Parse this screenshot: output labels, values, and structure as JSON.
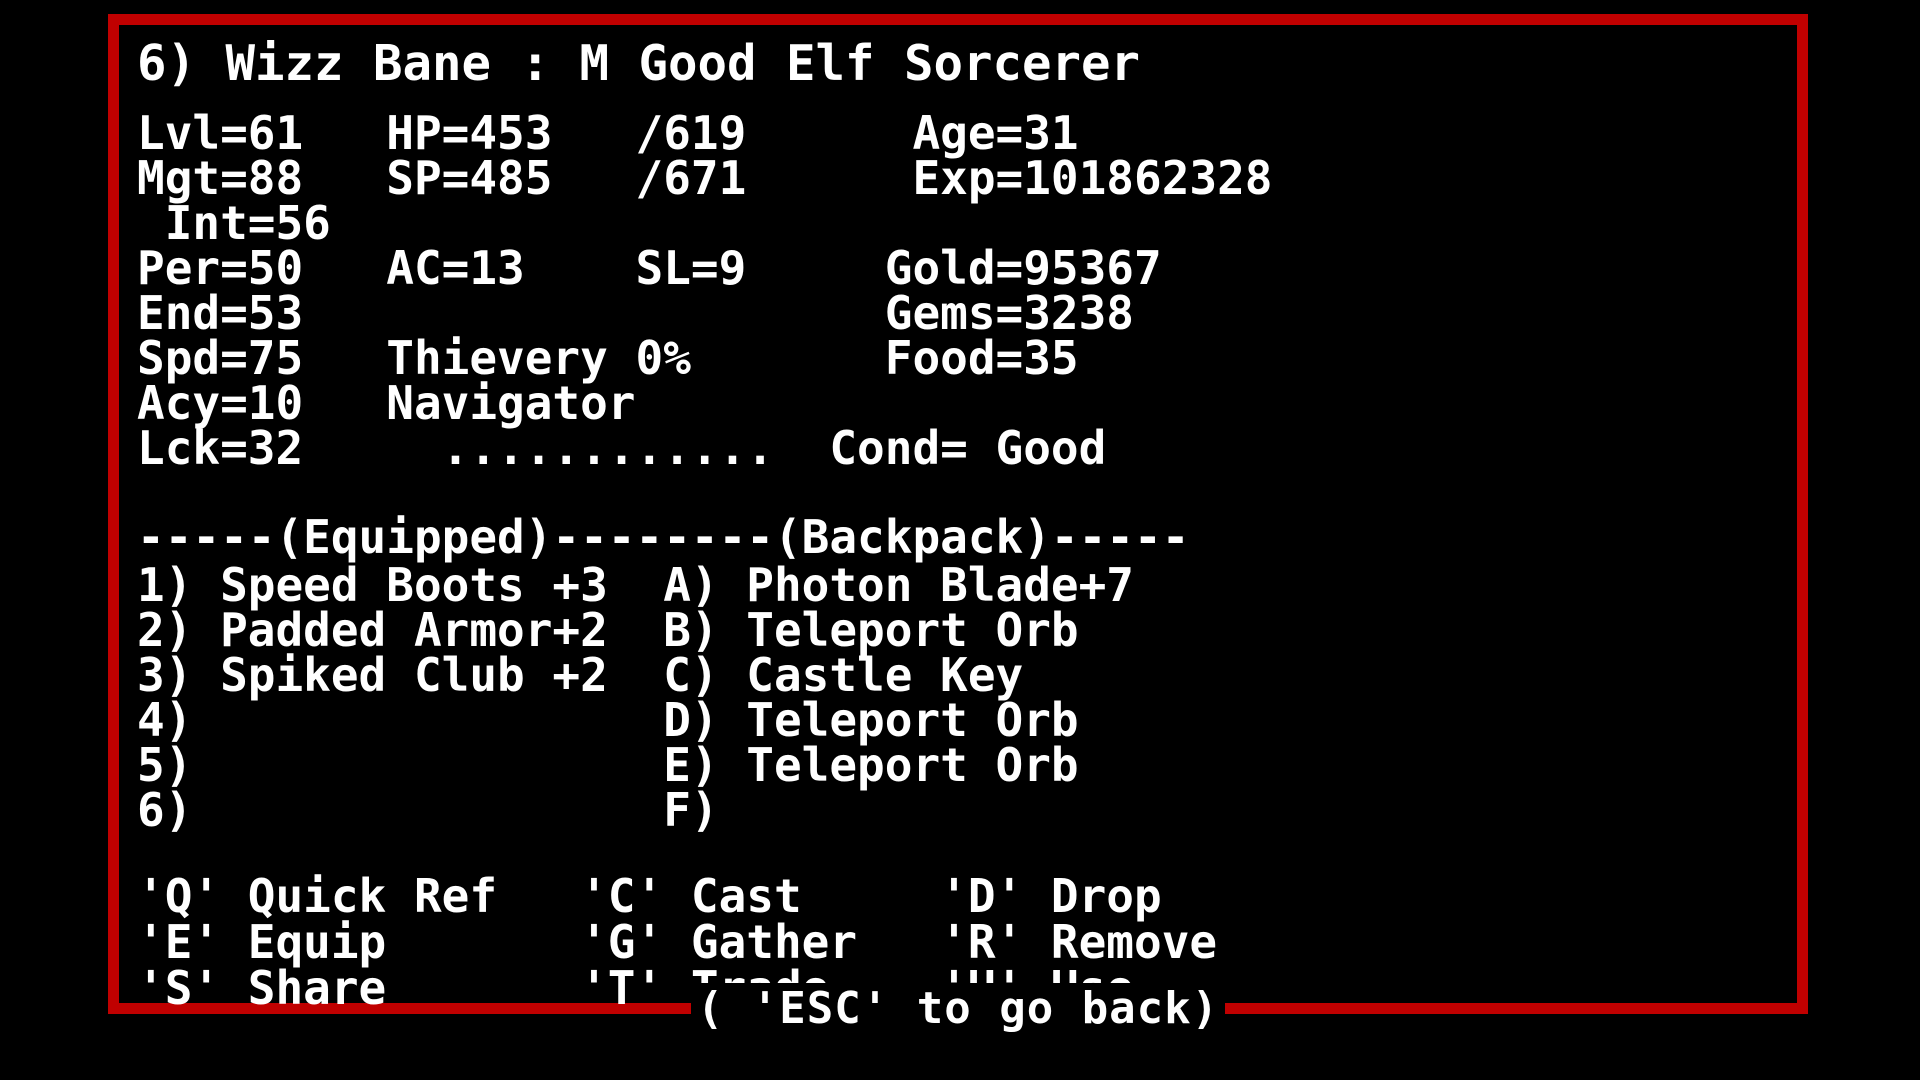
{
  "screen": {
    "background_color": "#000000",
    "text_color": "#ffffff",
    "border_color": "#c00000"
  },
  "header": {
    "line": "6) Wizz Bane : M Good Elf Sorcerer",
    "slot": "6)",
    "name": "Wizz Bane",
    "separator": ":",
    "sex": "M",
    "alignment": "Good",
    "race": "Elf",
    "class": "Sorcerer"
  },
  "stats": {
    "rows": [
      "Lvl=61   HP=453   /619      Age=31",
      "Mgt=88   SP=485   /671      Exp=101862328",
      " Int=56",
      "Per=50   AC=13    SL=9     Gold=95367",
      "End=53                     Gems=3238",
      "Spd=75   Thievery 0%       Food=35",
      "Acy=10   Navigator",
      "Lck=32     ............  Cond= Good"
    ],
    "values": {
      "Lvl": "61",
      "Mgt": "88",
      "Int": "56",
      "Per": "50",
      "End": "53",
      "Spd": "75",
      "Acy": "10",
      "Lck": "32",
      "HP": "453",
      "HP_max": "619",
      "SP": "485",
      "SP_max": "671",
      "AC": "13",
      "SL": "9",
      "Thievery": "0%",
      "Skill": "Navigator",
      "Age": "31",
      "Exp": "101862328",
      "Gold": "95367",
      "Gems": "3238",
      "Food": "35",
      "Cond": "Good"
    },
    "dots": "............"
  },
  "inventory": {
    "divider": "-----(Equipped)--------(Backpack)-----",
    "equipped_label": "(Equipped)",
    "backpack_label": "(Backpack)",
    "rows": [
      "1) Speed Boots +3  A) Photon Blade+7",
      "2) Padded Armor+2  B) Teleport Orb",
      "3) Spiked Club +2  C) Castle Key",
      "4)                 D) Teleport Orb",
      "5)                 E) Teleport Orb",
      "6)                 F)"
    ],
    "equipped": [
      {
        "key": "1)",
        "item": "Speed Boots +3"
      },
      {
        "key": "2)",
        "item": "Padded Armor+2"
      },
      {
        "key": "3)",
        "item": "Spiked Club +2"
      },
      {
        "key": "4)",
        "item": ""
      },
      {
        "key": "5)",
        "item": ""
      },
      {
        "key": "6)",
        "item": ""
      }
    ],
    "backpack": [
      {
        "key": "A)",
        "item": "Photon Blade+7"
      },
      {
        "key": "B)",
        "item": "Teleport Orb"
      },
      {
        "key": "C)",
        "item": "Castle Key"
      },
      {
        "key": "D)",
        "item": "Teleport Orb"
      },
      {
        "key": "E)",
        "item": "Teleport Orb"
      },
      {
        "key": "F)",
        "item": ""
      }
    ]
  },
  "commands": {
    "rows": [
      "'Q' Quick Ref   'C' Cast     'D' Drop",
      "'E' Equip       'G' Gather   'R' Remove",
      "'S' Share       'T' Trade    'U' Use"
    ],
    "items": [
      {
        "key": "'Q'",
        "label": "Quick Ref"
      },
      {
        "key": "'C'",
        "label": "Cast"
      },
      {
        "key": "'D'",
        "label": "Drop"
      },
      {
        "key": "'E'",
        "label": "Equip"
      },
      {
        "key": "'G'",
        "label": "Gather"
      },
      {
        "key": "'R'",
        "label": "Remove"
      },
      {
        "key": "'S'",
        "label": "Share"
      },
      {
        "key": "'T'",
        "label": "Trade"
      },
      {
        "key": "'U'",
        "label": "Use"
      }
    ]
  },
  "footer": {
    "hint": "( 'ESC' to go back)"
  }
}
